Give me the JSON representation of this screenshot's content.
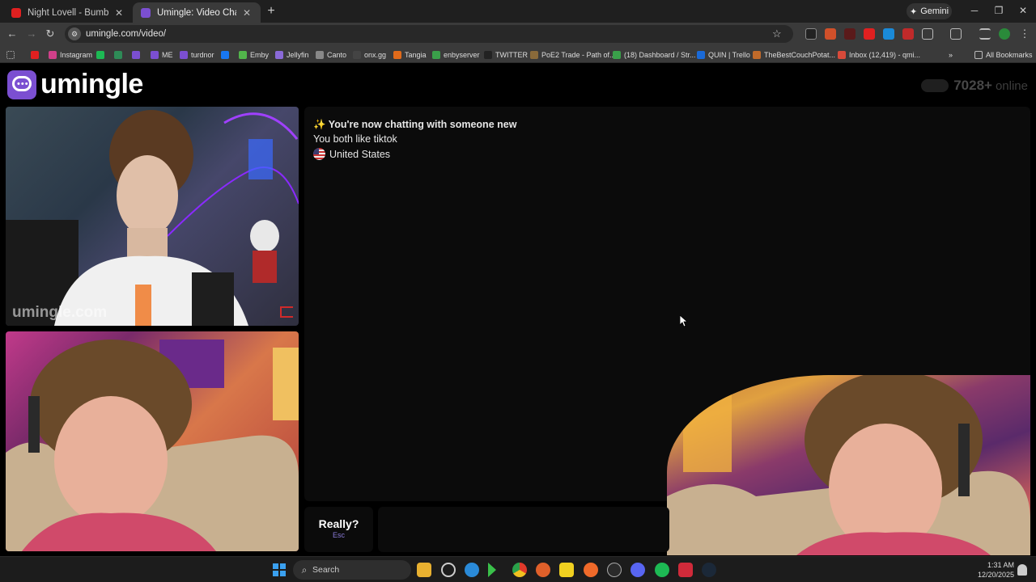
{
  "browser": {
    "tabs": [
      {
        "title": "Night Lovell - Bumblebee (KEIP",
        "favicon_color": "#e02020",
        "active": false
      },
      {
        "title": "Umingle: Video Chat with S",
        "favicon_color": "#7b4fd1",
        "active": true
      }
    ],
    "new_tab_glyph": "+",
    "gemini_label": "Gemini",
    "address_url": "umingle.com/video/",
    "bookmarks": [
      {
        "label": "",
        "color": "#e02020"
      },
      {
        "label": "Instagram",
        "color": "#d0408a"
      },
      {
        "label": "",
        "color": "#1db954"
      },
      {
        "label": "",
        "color": "#2e8b57"
      },
      {
        "label": "",
        "color": "#7b4fd1"
      },
      {
        "label": "ME",
        "color": "#7b4fd1"
      },
      {
        "label": "turdnor",
        "color": "#7b4fd1"
      },
      {
        "label": "",
        "color": "#1877f2"
      },
      {
        "label": "Emby",
        "color": "#52b54b"
      },
      {
        "label": "Jellyfin",
        "color": "#8a6ad8"
      },
      {
        "label": "Canto",
        "color": "#888888"
      },
      {
        "label": "onx.gg",
        "color": "#444444"
      },
      {
        "label": "Tangia",
        "color": "#e06a1a"
      },
      {
        "label": "enbyserver",
        "color": "#3aa04a"
      },
      {
        "label": "TWITTER",
        "color": "#222222"
      },
      {
        "label": "PoE2 Trade - Path of...",
        "color": "#8a6a3a"
      },
      {
        "label": "(18) Dashboard / Str...",
        "color": "#3aa04a"
      },
      {
        "label": "QUIN | Trello",
        "color": "#1a6ad8"
      },
      {
        "label": "TheBestCouchPotat...",
        "color": "#c06a2a"
      },
      {
        "label": "Inbox (12,419) - qmi...",
        "color": "#d84a3a"
      }
    ],
    "all_bookmarks_label": "All Bookmarks"
  },
  "site": {
    "logo_text": "umingle",
    "online_count": "7028+",
    "online_label": "online",
    "watermark": "umingle.com",
    "chat_messages": {
      "intro": "✨ You're now chatting with someone new",
      "interest": "You both like tiktok",
      "country": "United States"
    },
    "skip_button": {
      "label": "Really?",
      "key": "Esc"
    },
    "accent_color": "#7b4fd1"
  },
  "taskbar": {
    "search_label": "Search",
    "clock_time": "1:31 AM",
    "clock_date": "12/20/2025"
  }
}
